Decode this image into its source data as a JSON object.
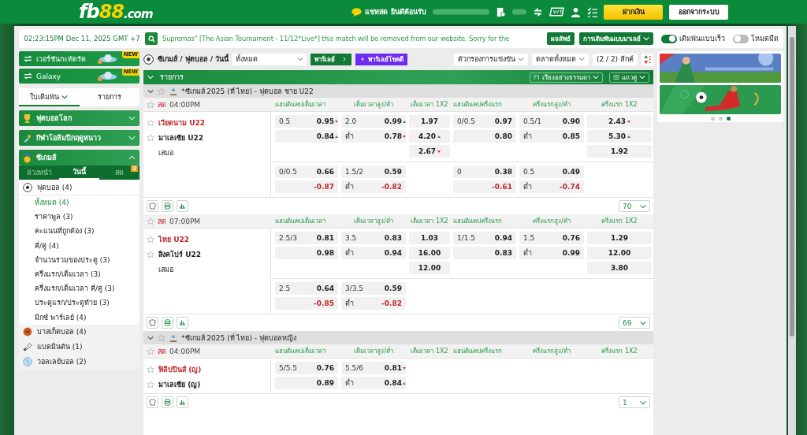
{
  "header": {
    "logo": [
      "fb",
      "88",
      ".com"
    ],
    "chat": "แชทสด",
    "welcome": "ยินดีต้อนรับ",
    "buttons": [
      "ฝากเงิน",
      "ออกจากระบบ"
    ]
  },
  "topbar": {
    "clock": "02:23:15PM Dec 11, 2025 GMT +7",
    "announcement": "Supremos\" [The Asian Tournament - 11/12*Live*] this match will be removed from our website. Sorry for the",
    "results": "ผลลัพธ์",
    "odds_type": "การเดิมพันแบบมาเลย์",
    "toggles": [
      {
        "label": "เดิมพันแบบเร็ว",
        "on": true
      },
      {
        "label": "โหมดมืด",
        "on": false
      }
    ]
  },
  "sidebar": {
    "versions": [
      {
        "label": "เวอร์ชันกะทัดรัด",
        "badge": "NEW"
      },
      {
        "label": "Galaxy",
        "badge": "NEW"
      }
    ],
    "tabs": [
      {
        "label": "ใบเดิมพัน",
        "selected": true
      },
      {
        "label": "รายการ",
        "selected": false
      }
    ],
    "sections": [
      {
        "title": "ฟุตบอลโลก",
        "expanded": false
      },
      {
        "title": "กีฬาโอลิมปิกฤดูหนาว",
        "expanded": false
      },
      {
        "title": "ซีเกมส์",
        "expanded": true,
        "tabs": [
          {
            "label": "ล่วงหน้า",
            "selected": false
          },
          {
            "label": "วันนี้",
            "selected": true
          },
          {
            "label": "สด",
            "selected": false,
            "badge": "2"
          }
        ],
        "sports": [
          {
            "label": "ฟุตบอล (4)",
            "expanded": true,
            "children": [
              {
                "label": "ทั้งหมด (4)",
                "selected": true
              },
              {
                "label": "ราคาพูล (3)",
                "selected": false
              },
              {
                "label": "คะแนนที่ถูกต้อง (3)",
                "selected": false
              },
              {
                "label": "คี่/คู่ (4)",
                "selected": false
              },
              {
                "label": "จำนวนรวมของประตู (3)",
                "selected": false
              },
              {
                "label": "ครึ่งแรก/เต็มเวลา (3)",
                "selected": false
              },
              {
                "label": "ครึ่งแรก/เต็มเวลา คี่/คู่ (3)",
                "selected": false
              },
              {
                "label": "ประตูแรก/ประตูท้าย (3)",
                "selected": false
              },
              {
                "label": "มิกซ์ พาร์เลย์ (4)",
                "selected": false
              }
            ]
          },
          {
            "label": "บาสเก็ตบอล (4)",
            "expanded": false
          },
          {
            "label": "แบดมินตัน (1)",
            "expanded": false
          },
          {
            "label": "วอลเลย์บอล (2)",
            "expanded": false
          }
        ]
      }
    ]
  },
  "toolbar": {
    "breadcrumb": "ซีเกมส์ / ฟุตบอล / วันนี้",
    "select": "ทั้งหมด",
    "parlay": "พาร์เลย์",
    "lucky": "พาร์เลย์โชคดี",
    "filters": [
      "ตัวกรองการแข่งขัน",
      "ตลาดทั้งหมด"
    ],
    "leagues": "(2 / 2) ลีกค์"
  },
  "list": {
    "title": "รายการ",
    "sort": "เรียงอย่างธรรมดา",
    "view": "แถวคู่"
  },
  "leagues": [
    {
      "title": "*ซีเกมส์ 2025 (ที่ ไทย) - ฟุตบอล ชาย U22",
      "matches": [
        {
          "live": "สด",
          "time": "04:00PM",
          "columns": [
            "แฮนดิแคปเต็มเวลา",
            "เต็มเวลาสูง/ต่ำ",
            "เต็มเวลา 1X2",
            "แฮนดิแคปครึ่งแรก",
            "ครึ่งแรกสูง/ต่ำ",
            "ครึ่งแรก 1X2"
          ],
          "teams": [
            {
              "name": "เวียดนาม U22",
              "kind": "team",
              "favored": true
            },
            {
              "name": "มาเลเซีย U22",
              "kind": "team",
              "favored": false
            },
            {
              "name": "เสมอ",
              "kind": "draw",
              "favored": false
            }
          ],
          "blocks": [
            [
              {
                "ft_handicap": {
                  "line": "0.5",
                  "odds": "0.95",
                  "up": false,
                  "down": true,
                  "negative": false
                },
                "ft_over_under": {
                  "line": "2.0",
                  "odds": "0.99",
                  "up": true,
                  "down": false,
                  "negative": false
                },
                "ft_1x2": {
                  "odds": "1.97",
                  "up": false,
                  "down": false,
                  "negative": false
                },
                "h1_handicap": {
                  "line": "0/0.5",
                  "odds": "0.97",
                  "up": false,
                  "down": false,
                  "negative": false
                },
                "h1_over_under": {
                  "line": "0.5/1",
                  "odds": "0.90",
                  "up": false,
                  "down": false,
                  "negative": false
                },
                "h1_1x2": {
                  "odds": "2.43",
                  "up": false,
                  "down": true,
                  "negative": false
                }
              },
              {
                "ft_handicap": {
                  "odds": "0.84",
                  "up": true,
                  "down": false,
                  "negative": false
                },
                "ft_over_under": {
                  "line": "ต่ำ",
                  "odds": "0.78",
                  "up": false,
                  "down": true,
                  "negative": false
                },
                "ft_1x2": {
                  "odds": "4.20",
                  "up": true,
                  "down": false,
                  "negative": false
                },
                "h1_handicap": {
                  "odds": "0.80",
                  "up": false,
                  "down": false,
                  "negative": false
                },
                "h1_over_under": {
                  "line": "ต่ำ",
                  "odds": "0.85",
                  "up": false,
                  "down": false,
                  "negative": false
                },
                "h1_1x2": {
                  "odds": "5.30",
                  "up": true,
                  "down": false,
                  "negative": false
                }
              },
              {
                "ft_1x2": {
                  "odds": "2.67",
                  "up": false,
                  "down": true,
                  "negative": false
                },
                "h1_1x2": {
                  "odds": "1.92",
                  "up": false,
                  "down": false,
                  "negative": false
                }
              }
            ],
            [
              {
                "ft_handicap": {
                  "line": "0/0.5",
                  "odds": "0.66",
                  "up": false,
                  "down": false,
                  "negative": false
                },
                "ft_over_under": {
                  "line": "1.5/2",
                  "odds": "0.59",
                  "up": false,
                  "down": false,
                  "negative": false
                },
                "h1_handicap": {
                  "line": "0",
                  "odds": "0.38",
                  "up": false,
                  "down": false,
                  "negative": false
                },
                "h1_over_under": {
                  "line": "0.5",
                  "odds": "0.49",
                  "up": false,
                  "down": false,
                  "negative": false
                }
              },
              {
                "ft_handicap": {
                  "odds": "-0.87",
                  "up": false,
                  "down": false,
                  "negative": true
                },
                "ft_over_under": {
                  "line": "ต่ำ",
                  "odds": "-0.82",
                  "up": false,
                  "down": false,
                  "negative": true
                },
                "h1_handicap": {
                  "odds": "-0.61",
                  "up": false,
                  "down": false,
                  "negative": true
                },
                "h1_over_under": {
                  "line": "ต่ำ",
                  "odds": "-0.74",
                  "up": false,
                  "down": false,
                  "negative": true
                }
              }
            ]
          ],
          "more": "70"
        },
        {
          "live": "สด",
          "time": "07:00PM",
          "columns": [
            "แฮนดิแคปเต็มเวลา",
            "เต็มเวลาสูง/ต่ำ",
            "เต็มเวลา 1X2",
            "แฮนดิแคปครึ่งแรก",
            "ครึ่งแรกสูง/ต่ำ",
            "ครึ่งแรก 1X2"
          ],
          "teams": [
            {
              "name": "ไทย U22",
              "kind": "team",
              "favored": true
            },
            {
              "name": "สิงคโปร์ U22",
              "kind": "team",
              "favored": false
            },
            {
              "name": "เสมอ",
              "kind": "draw",
              "favored": false
            }
          ],
          "blocks": [
            [
              {
                "ft_handicap": {
                  "line": "2.5/3",
                  "odds": "0.81",
                  "up": false,
                  "down": false,
                  "negative": false
                },
                "ft_over_under": {
                  "line": "3.5",
                  "odds": "0.83",
                  "up": false,
                  "down": false,
                  "negative": false
                },
                "ft_1x2": {
                  "odds": "1.03",
                  "up": false,
                  "down": false,
                  "negative": false
                },
                "h1_handicap": {
                  "line": "1/1.5",
                  "odds": "0.94",
                  "up": false,
                  "down": false,
                  "negative": false
                },
                "h1_over_under": {
                  "line": "1.5",
                  "odds": "0.76",
                  "up": false,
                  "down": false,
                  "negative": false
                },
                "h1_1x2": {
                  "odds": "1.29",
                  "up": false,
                  "down": false,
                  "negative": false
                }
              },
              {
                "ft_handicap": {
                  "odds": "0.98",
                  "up": false,
                  "down": false,
                  "negative": false
                },
                "ft_over_under": {
                  "line": "ต่ำ",
                  "odds": "0.94",
                  "up": false,
                  "down": false,
                  "negative": false
                },
                "ft_1x2": {
                  "odds": "16.00",
                  "up": false,
                  "down": false,
                  "negative": false
                },
                "h1_handicap": {
                  "odds": "0.83",
                  "up": false,
                  "down": false,
                  "negative": false
                },
                "h1_over_under": {
                  "line": "ต่ำ",
                  "odds": "0.99",
                  "up": false,
                  "down": false,
                  "negative": false
                },
                "h1_1x2": {
                  "odds": "12.00",
                  "up": false,
                  "down": false,
                  "negative": false
                }
              },
              {
                "ft_1x2": {
                  "odds": "12.00",
                  "up": false,
                  "down": false,
                  "negative": false
                },
                "h1_1x2": {
                  "odds": "3.80",
                  "up": false,
                  "down": false,
                  "negative": false
                }
              }
            ],
            [
              {
                "ft_handicap": {
                  "line": "2.5",
                  "odds": "0.64",
                  "up": false,
                  "down": false,
                  "negative": false
                },
                "ft_over_under": {
                  "line": "3/3.5",
                  "odds": "0.59",
                  "up": false,
                  "down": false,
                  "negative": false
                }
              },
              {
                "ft_handicap": {
                  "odds": "-0.85",
                  "up": false,
                  "down": false,
                  "negative": true
                },
                "ft_over_under": {
                  "line": "ต่ำ",
                  "odds": "-0.82",
                  "up": false,
                  "down": false,
                  "negative": true
                }
              }
            ]
          ],
          "more": "69"
        }
      ]
    },
    {
      "title": "*ซีเกมส์ 2025 (ที่ ไทย) - ฟุตบอลหญิง",
      "matches": [
        {
          "live": "สด",
          "time": "04:00PM",
          "columns": [
            "แฮนดิแคปเต็มเวลา",
            "เต็มเวลาสูง/ต่ำ",
            "เต็มเวลา 1X2",
            "แฮนดิแคปครึ่งแรก",
            "ครึ่งแรกสูง/ต่ำ",
            "ครึ่งแรก 1X2"
          ],
          "teams": [
            {
              "name": "ฟิลิปปินส์ (ญ)",
              "kind": "team",
              "favored": true
            },
            {
              "name": "มาเลเซีย (ญ)",
              "kind": "team",
              "favored": false
            }
          ],
          "blocks": [
            [
              {
                "ft_handicap": {
                  "line": "5/5.5",
                  "odds": "0.76",
                  "up": false,
                  "down": false,
                  "negative": false
                },
                "ft_over_under": {
                  "line": "5.5/6",
                  "odds": "0.81",
                  "up": false,
                  "down": true,
                  "negative": false
                }
              },
              {
                "ft_handicap": {
                  "odds": "0.89",
                  "up": false,
                  "down": false,
                  "negative": false
                },
                "ft_over_under": {
                  "line": "ต่ำ",
                  "odds": "0.84",
                  "up": true,
                  "down": false,
                  "negative": false
                }
              }
            ]
          ],
          "more": "1"
        }
      ]
    }
  ],
  "banners": {
    "dots": [
      {
        "selected": false
      },
      {
        "selected": false
      },
      {
        "selected": true
      }
    ]
  }
}
